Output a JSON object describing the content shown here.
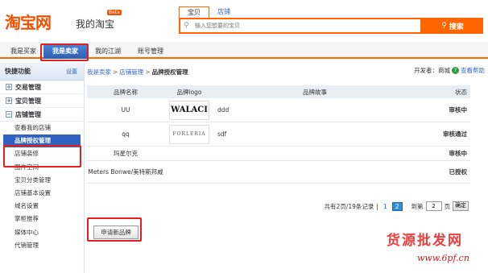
{
  "brand": {
    "logo": "淘宝网",
    "sub": "我的淘宝",
    "beta": "Beta"
  },
  "search": {
    "tabs": [
      "宝贝",
      "店铺"
    ],
    "placeholder": "输入您想要的宝贝",
    "button": "搜索"
  },
  "nav": {
    "items": [
      "我是买家",
      "我是卖家",
      "我的江湖",
      "账号管理"
    ]
  },
  "sidebar": {
    "title": "快捷功能",
    "settings": "设置",
    "sections": [
      "交易管理",
      "宝贝管理",
      "店铺管理"
    ],
    "items": [
      "查看我的店铺",
      "品牌授权管理",
      "店铺装修",
      "图片空间",
      "宝贝分类管理",
      "店铺基本设置",
      "域名设置",
      "掌柜推荐",
      "媒体中心",
      "代销管理"
    ]
  },
  "breadcrumb": {
    "a": "我是卖家",
    "b": "店铺管理",
    "cur": "品牌授权管理",
    "dev_label": "开发者：商城",
    "help": "查看帮助"
  },
  "table": {
    "headers": [
      "品牌名称",
      "品牌logo",
      "品牌故事",
      "状态"
    ],
    "rows": [
      {
        "name": "UU",
        "logo": "WALACI",
        "story": "ddd",
        "status": "审核中"
      },
      {
        "name": "qq",
        "logo": "FORLERIA",
        "story": "sdf",
        "status": "审核通过"
      },
      {
        "name": "玛星尔克",
        "logo": "",
        "story": "",
        "status": "审核中"
      },
      {
        "name": "Meters Bonwe/美特斯邦威",
        "logo": "",
        "story": "",
        "status": "已授权"
      }
    ]
  },
  "pager": {
    "summary": "共有2页/19条记录",
    "pages": [
      "1",
      "2"
    ],
    "goto_pre": "到第",
    "goto_val": "2",
    "goto_post": "页",
    "confirm": "确定"
  },
  "apply": {
    "label": "申请新品牌"
  },
  "watermark": {
    "line1": "货源批发网",
    "line2": "www.6pf.cn"
  },
  "colors": {
    "accent": "#ff6600",
    "nav_active": "#2d5fb3",
    "highlight": "#e02020"
  }
}
